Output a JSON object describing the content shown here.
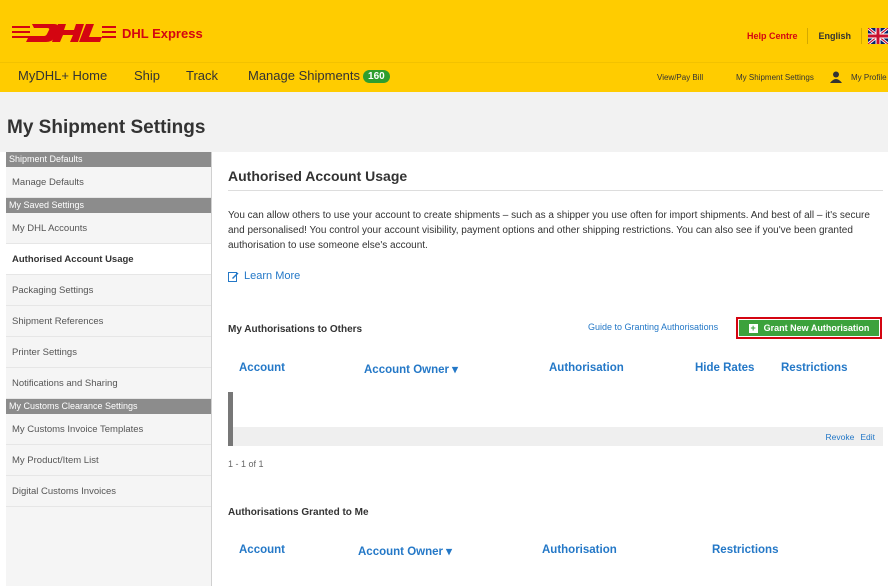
{
  "brand": {
    "name": "DHL Express",
    "colors": {
      "yellow": "#ffcc00",
      "red": "#d40511",
      "green": "#3ca23c",
      "link": "#2478c7"
    }
  },
  "top_links": {
    "help": "Help Centre",
    "language": "English"
  },
  "nav": {
    "home": "MyDHL+ Home",
    "ship": "Ship",
    "track": "Track",
    "manage": "Manage Shipments",
    "manage_count": "160",
    "view_pay": "View/Pay Bill",
    "shipment_settings": "My Shipment Settings",
    "profile": "My Profile"
  },
  "page": {
    "title": "My Shipment Settings"
  },
  "sidebar": {
    "sections": [
      {
        "heading": "Shipment Defaults",
        "items": [
          "Manage Defaults"
        ]
      },
      {
        "heading": "My Saved Settings",
        "items": [
          "My DHL Accounts",
          "Authorised Account Usage",
          "Packaging Settings",
          "Shipment References",
          "Printer Settings",
          "Notifications and Sharing"
        ]
      },
      {
        "heading": "My Customs Clearance Settings",
        "items": [
          "My Customs Invoice Templates",
          "My Product/Item List",
          "Digital Customs Invoices"
        ]
      }
    ],
    "active": "Authorised Account Usage"
  },
  "main": {
    "title": "Authorised Account Usage",
    "description": "You can allow others to use your account to create shipments – such as a shipper you use often for import shipments. And best of all – it's secure and personalised! You control your account visibility, payment options and other shipping restrictions. You can also see if you've been granted authorisation to use someone else's account.",
    "learn_more": "Learn More",
    "to_others": {
      "title": "My Authorisations to Others",
      "guide_link": "Guide to Granting Authorisations",
      "grant_button": "Grant New Authorisation",
      "columns": [
        "Account",
        "Account Owner ▾",
        "Authorisation",
        "Hide Rates",
        "Restrictions"
      ],
      "row_actions": [
        "Revoke",
        "Edit"
      ],
      "count": "1 - 1 of 1"
    },
    "granted_to_me": {
      "title": "Authorisations Granted to Me",
      "columns": [
        "Account",
        "Account Owner ▾",
        "Authorisation",
        "Restrictions"
      ]
    }
  }
}
